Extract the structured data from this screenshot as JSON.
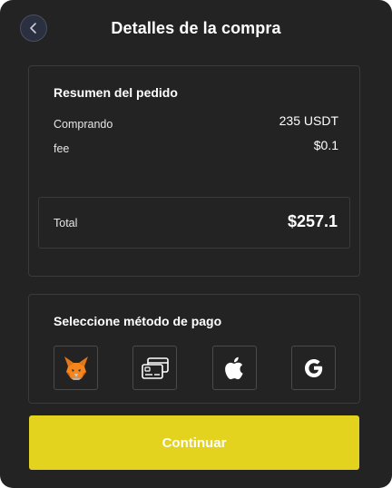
{
  "header": {
    "title": "Detalles de la compra",
    "back_icon": "chevron-left-icon"
  },
  "summary": {
    "heading": "Resumen del pedido",
    "rows": [
      {
        "label": "Comprando",
        "value": "235 USDT"
      },
      {
        "label": "fee",
        "value": "$0.1"
      }
    ],
    "total_label": "Total",
    "total_value": "$257.1"
  },
  "payment": {
    "heading": "Seleccione método de pago",
    "methods": [
      {
        "name": "metamask",
        "icon": "metamask-fox-icon"
      },
      {
        "name": "cards",
        "icon": "credit-cards-icon"
      },
      {
        "name": "apple-pay",
        "icon": "apple-icon"
      },
      {
        "name": "google-pay",
        "icon": "google-icon"
      }
    ]
  },
  "actions": {
    "continue_label": "Continuar"
  },
  "colors": {
    "panel_bg": "#232323",
    "accent": "#e3d31e",
    "border": "#3a3a3a"
  }
}
